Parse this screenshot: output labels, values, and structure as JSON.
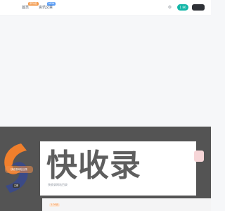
{
  "topbar": {
    "nav": [
      {
        "label": "首页",
        "badge": "新功能"
      },
      {
        "label": "资讯文章",
        "badge": "NEW"
      }
    ],
    "teal_pill": "1 86",
    "dark_pill": ""
  },
  "promo": {
    "logo_bubble": "快收录网站目录",
    "logo_button": "立即",
    "watermark": "快收录",
    "caption": "快收录网站目录",
    "tag": "1.00元"
  },
  "colors": {
    "accent_teal": "#14b6a7",
    "badge_orange": "#f39a4c",
    "badge_blue": "#3d8bff",
    "dim_overlay": "#545454"
  },
  "icons": [
    "settings-icon",
    "logo-icon"
  ]
}
